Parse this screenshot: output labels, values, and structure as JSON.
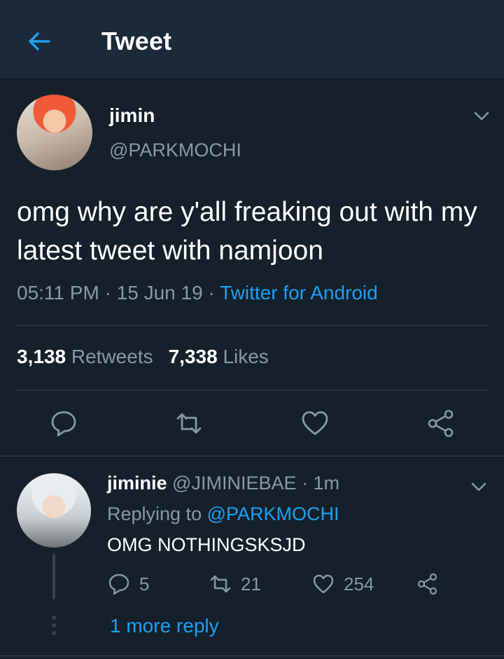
{
  "header": {
    "title": "Tweet",
    "back_icon": "arrow-left-icon"
  },
  "colors": {
    "background": "#15202b",
    "header": "#1c2938",
    "accent": "#1da1f2",
    "muted": "#8899a6"
  },
  "tweet": {
    "author_name": "jimin",
    "author_handle": "@PARKMOCHI",
    "text": "omg why are y'all freaking out with my latest tweet with namjoon",
    "time": "05:11 PM",
    "sep1": " · ",
    "date": "15 Jun 19",
    "sep2": " · ",
    "source": "Twitter for Android",
    "retweets_count": "3,138",
    "retweets_label": "Retweets",
    "likes_count": "7,338",
    "likes_label": "Likes"
  },
  "reply": {
    "author_name": "jiminie",
    "author_handle": "@JIMINIEBAE",
    "sep": " · ",
    "time": "1m",
    "replying_prefix": "Replying to",
    "replying_to": "@PARKMOCHI",
    "text": "OMG NOTHINGSKSJD",
    "reply_count": "5",
    "retweet_count": "21",
    "like_count": "254"
  },
  "more_reply_label": "1 more reply"
}
